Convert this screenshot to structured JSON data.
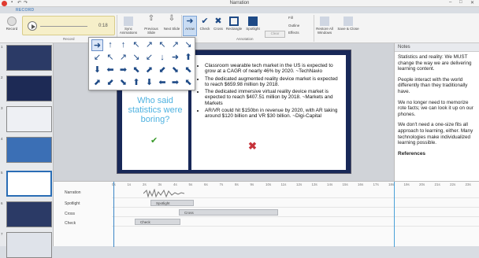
{
  "window": {
    "title": "Narration",
    "record_tab": "RECORD"
  },
  "ribbon": {
    "record_label": "Record",
    "audio_time": "0:18",
    "group_record": "Record",
    "sync_label": "Sync Animations",
    "prev_label": "Previous Slide",
    "next_label": "Next Slide",
    "arrow_label": "Arrow",
    "check_label": "Check",
    "cross_label": "Cross",
    "rectangle_label": "Rectangle",
    "spotlight_label": "Spotlight",
    "clear_label": "Clear",
    "fill_label": "Fill",
    "outline_label": "Outline",
    "effects_label": "Effects",
    "group_annotation": "Annotation",
    "restore_label": "Restore All Windows",
    "save_label": "Save & Close"
  },
  "slide": {
    "left_text": "Who said statistics were boring?",
    "bullets": [
      "Classroom wearable tech market in the US is expected to grow at a CAGR of nearly 46% by 2020. ~TechNavio",
      "The dedicated augmented reality device market is expected to reach $659.98 million by 2018.",
      "The dedicated immersive virtual reality device market is expected to reach $407.51 million by 2018. ~Markets and Markets",
      "AR/VR could hit $150bn in revenue by 2020, with AR taking around $120 billion and VR $30 billion. ~Digi-Capital"
    ]
  },
  "notes": {
    "header": "Notes",
    "paragraphs": [
      "Statistics and reality: We MUST change the way we are delivering learning content.",
      "People interact with the world differently than they traditionally have.",
      "We no longer need to memorize rote facts; we can look it up on our phones.",
      "We don't need a one-size fits all approach to learning, either. Many technologies make individualized learning possible."
    ],
    "references_heading": "References"
  },
  "thumbnails": [
    "1",
    "2",
    "3",
    "4",
    "5",
    "6",
    "7"
  ],
  "timeline": {
    "rows": [
      "Narration",
      "Spotlight",
      "Cross",
      "Check"
    ],
    "ruler": [
      "0s",
      "1s",
      "2s",
      "3s",
      "4s",
      "5s",
      "6s",
      "7s",
      "8s",
      "9s",
      "10s",
      "11s",
      "12s",
      "13s",
      "14s",
      "15s",
      "16s",
      "17s",
      "18s",
      "19s",
      "20s",
      "21s",
      "22s",
      "23s"
    ],
    "clips": {
      "spotlight": "Spotlight",
      "cross": "Cross",
      "check": "Check"
    }
  },
  "arrow_glyphs": [
    "➜",
    "↑",
    "↑",
    "↖",
    "↗",
    "↖",
    "↗",
    "↘",
    "↙",
    "↖",
    "↗",
    "↘",
    "↙",
    "↓",
    "➜",
    "⬆",
    "⬇",
    "⬅",
    "➡",
    "⬉",
    "⬈",
    "⬋",
    "⬊",
    "⬉",
    "⬈",
    "⬋",
    "⬊",
    "⬆",
    "⬇",
    "⬅",
    "➡",
    "⬉",
    "⬈",
    "⬋",
    "⬊",
    "⬆",
    "⬇",
    "⬅",
    "➡",
    "⬉",
    "⬈",
    "⬋"
  ],
  "colors": {
    "accent": "#2a6db5",
    "slide_bg": "#182858",
    "said_text": "#4fb2e0",
    "cross": "#c6323a",
    "check": "#3a9a2a"
  }
}
